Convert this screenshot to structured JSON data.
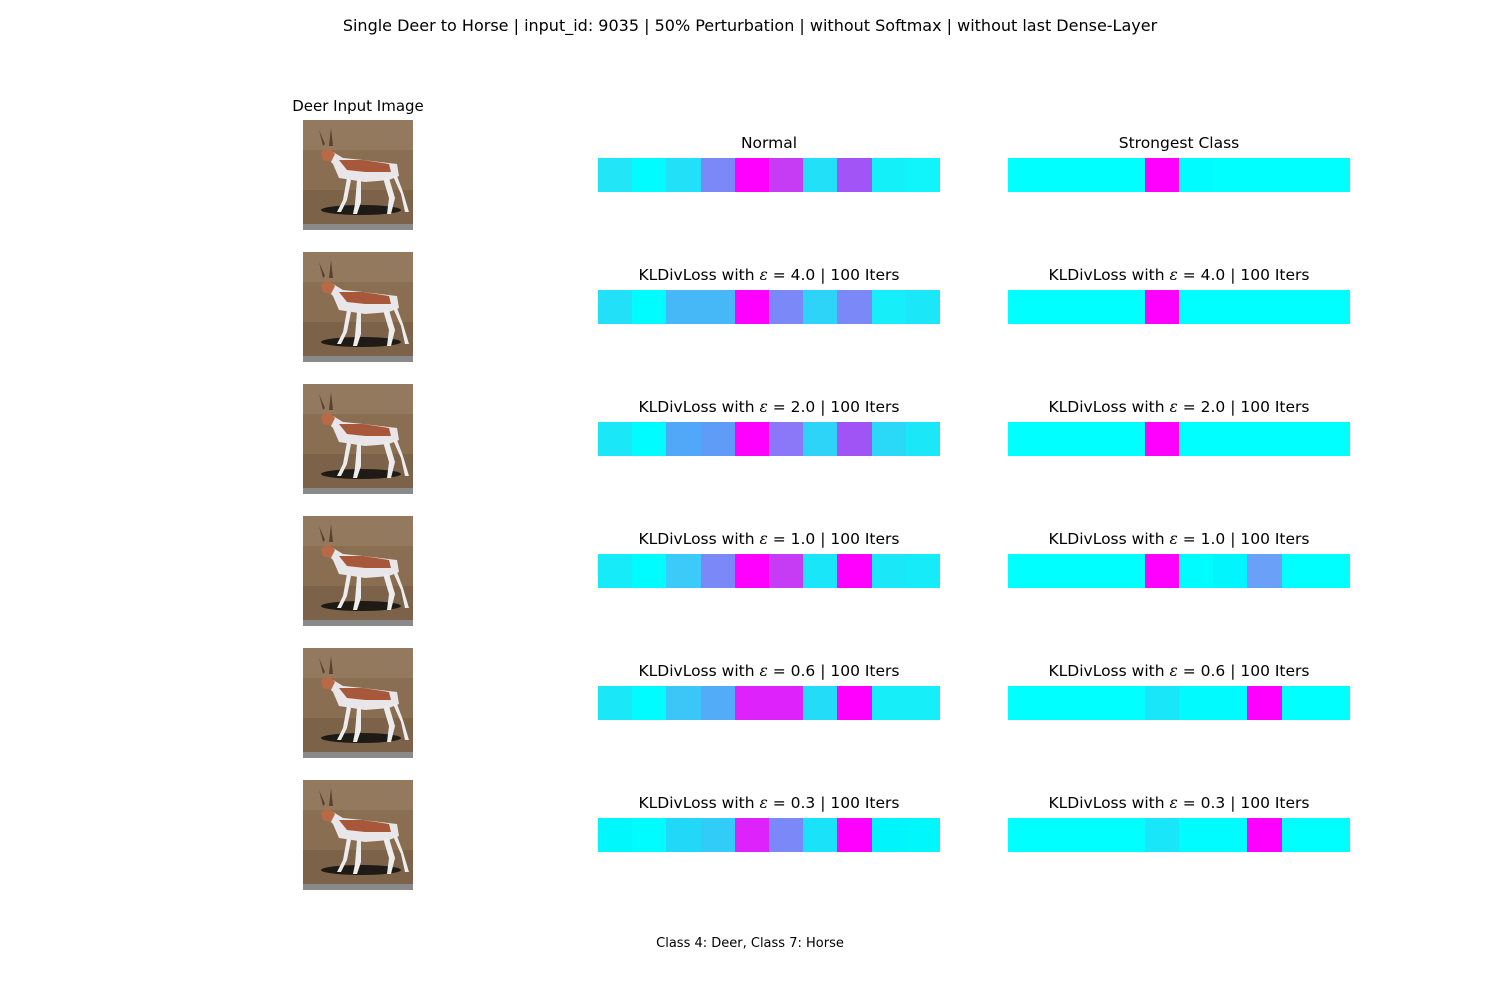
{
  "suptitle": "Single Deer to Horse | input_id: 9035 | 50% Perturbation | without Softmax | without last Dense-Layer",
  "footer": "Class 4: Deer, Class 7: Horse",
  "input_image_title": "Deer Input Image",
  "rows": [
    {
      "left_title": "Normal",
      "right_title": "Strongest Class",
      "left_colors": [
        "#22e6f8",
        "#00fcfe",
        "#22e0f8",
        "#7a88f8",
        "#ff00ff",
        "#c63cf4",
        "#22e0f8",
        "#a254f6",
        "#14f0fa",
        "#10f4fb"
      ],
      "right_colors": [
        "#00ffff",
        "#00ffff",
        "#00ffff",
        "#00ffff",
        "#ff00ff",
        "#00fcfe",
        "#00ffff",
        "#00ffff",
        "#00ffff",
        "#00ffff"
      ]
    },
    {
      "left_title": "KLDivLoss with ε = 4.0 | 100 Iters",
      "right_title": "KLDivLoss with ε = 4.0 | 100 Iters",
      "left_colors": [
        "#22e0f8",
        "#00fcfe",
        "#46b8f8",
        "#46b8f8",
        "#ff00ff",
        "#7a88f8",
        "#2ed4f8",
        "#7a88f8",
        "#16eef9",
        "#1ae8f9"
      ],
      "right_colors": [
        "#00ffff",
        "#00ffff",
        "#00ffff",
        "#00ffff",
        "#ff00ff",
        "#00ffff",
        "#00ffff",
        "#00ffff",
        "#00ffff",
        "#00ffff"
      ]
    },
    {
      "left_title": "KLDivLoss with ε = 2.0 | 100 Iters",
      "right_title": "KLDivLoss with ε = 2.0 | 100 Iters",
      "left_colors": [
        "#1ae8f9",
        "#00fcfe",
        "#52a8f8",
        "#5e9cf8",
        "#ff00ff",
        "#8a78f8",
        "#2ed4f8",
        "#a054f6",
        "#2ad8f8",
        "#1ae8f9"
      ],
      "right_colors": [
        "#00ffff",
        "#00ffff",
        "#00ffff",
        "#00ffff",
        "#ff00ff",
        "#00ffff",
        "#00ffff",
        "#00ffff",
        "#00ffff",
        "#00ffff"
      ]
    },
    {
      "left_title": "KLDivLoss with ε = 1.0 | 100 Iters",
      "right_title": "KLDivLoss with ε = 1.0 | 100 Iters",
      "left_colors": [
        "#16ecf9",
        "#00fcfe",
        "#3ccaf8",
        "#7a88f8",
        "#ff00ff",
        "#c63cf4",
        "#1ae6f9",
        "#ff00ff",
        "#1ae8f9",
        "#16ecf9"
      ],
      "right_colors": [
        "#00ffff",
        "#00ffff",
        "#00ffff",
        "#00ffff",
        "#ff00ff",
        "#00fcfe",
        "#00f6fc",
        "#6aa0f8",
        "#00ffff",
        "#00ffff"
      ]
    },
    {
      "left_title": "KLDivLoss with ε = 0.6 | 100 Iters",
      "right_title": "KLDivLoss with ε = 0.6 | 100 Iters",
      "left_colors": [
        "#1ae8f9",
        "#00fcfe",
        "#3cc6f8",
        "#52acf8",
        "#de22fc",
        "#de22fc",
        "#22dcf8",
        "#ff00ff",
        "#16eef9",
        "#16eef9"
      ],
      "right_colors": [
        "#00ffff",
        "#00ffff",
        "#00ffff",
        "#00ffff",
        "#1ae6f9",
        "#00fafe",
        "#00fafe",
        "#ff00ff",
        "#00ffff",
        "#00ffff"
      ]
    },
    {
      "left_title": "KLDivLoss with ε = 0.3 | 100 Iters",
      "right_title": "KLDivLoss with ε = 0.3 | 100 Iters",
      "left_colors": [
        "#00f8fd",
        "#00fcfe",
        "#22d8f8",
        "#32ccf8",
        "#de22fc",
        "#7a88f8",
        "#1ae2f9",
        "#ff00ff",
        "#00f4fc",
        "#00f8fd"
      ],
      "right_colors": [
        "#00ffff",
        "#00ffff",
        "#00ffff",
        "#00ffff",
        "#1ae6f9",
        "#00fcfe",
        "#00fcfe",
        "#ff00ff",
        "#00ffff",
        "#00ffff"
      ]
    }
  ]
}
